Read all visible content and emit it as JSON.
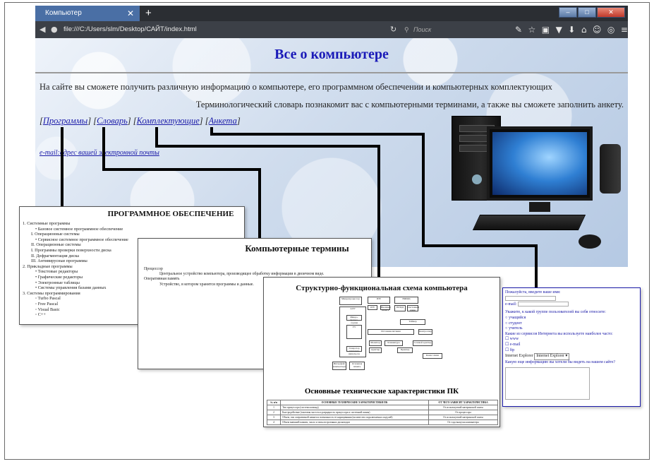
{
  "browser": {
    "tab_title": "Компьютер",
    "tab_close": "✕",
    "new_tab": "+",
    "url": "file:///C:/Users/slm/Desktop/САЙТ/index.html",
    "search_placeholder": "Поиск",
    "window_buttons": [
      "–",
      "□",
      "✕"
    ],
    "toolbar_icons": [
      "wrench-icon",
      "star-icon",
      "clipboard-icon",
      "pocket-icon",
      "download-icon",
      "home-icon",
      "chat-icon",
      "sync-icon",
      "menu-icon"
    ]
  },
  "page": {
    "title": "Все о компьютере",
    "intro1": "На сайте вы сможете получить различную информацию о компьютере, его программном обеспечении и компьютерных комплектующих",
    "intro2": "Терминологический словарь познакомит вас с компьютерными терминами, а также вы сможете заполнить анкету.",
    "nav": [
      "Программы",
      "Словарь",
      "Комплектующие",
      "Анкета"
    ],
    "email_link": "e-mail:адрес вашей электронной почты"
  },
  "software_window": {
    "title": "ПРОГРАММНОЕ ОБЕСПЕЧЕНИЕ",
    "items": [
      {
        "level": "l1",
        "text": "1. Системные программы"
      },
      {
        "level": "l2",
        "text": "• Базовое системное программное обеспечение"
      },
      {
        "level": "l3",
        "text": "I. Операционные системы"
      },
      {
        "level": "l2",
        "text": "• Сервисное системное программное обеспечение"
      },
      {
        "level": "l3",
        "text": "II. Операционные системы"
      },
      {
        "level": "l3",
        "text": "I. Программы проверки поверхности диска"
      },
      {
        "level": "l3",
        "text": "II. Дефрагментация диска"
      },
      {
        "level": "l3",
        "text": "III. Антивирусные программы"
      },
      {
        "level": "l1",
        "text": "2. Прикладные программы"
      },
      {
        "level": "l2",
        "text": "• Текстовые редакторы"
      },
      {
        "level": "l2",
        "text": "• Графические редакторы"
      },
      {
        "level": "l2",
        "text": "• Электронные таблицы"
      },
      {
        "level": "l2",
        "text": "• Системы управления базами данных"
      },
      {
        "level": "l1",
        "text": "3. Системы программирования"
      },
      {
        "level": "l2",
        "text": "◦ Turbo Pascal"
      },
      {
        "level": "l2",
        "text": "◦ Free Pascal"
      },
      {
        "level": "l2",
        "text": "◦ Visual Basic"
      },
      {
        "level": "l2",
        "text": "◦ C++"
      }
    ]
  },
  "terms_window": {
    "title": "Компьютерные термины",
    "lines": [
      {
        "ind": false,
        "text": "Процессор"
      },
      {
        "ind": true,
        "text": "Центральное устройство компьютера, производящее обработку информации в двоичном виде."
      },
      {
        "ind": false,
        "text": "Оперативная память"
      },
      {
        "ind": true,
        "text": "Устройство, в котором хранятся программы и данные."
      }
    ]
  },
  "components_window": {
    "title": "Структурно-функциональная схема компьютера",
    "diagram_boxes": [
      "Микропроцессор",
      "АЛУ",
      "Микро-процес-сорная память",
      "УУ",
      "Генератор тактовых импульсов",
      "Интерфейс компьютера",
      "Основная память",
      "ПЗУ",
      "ОЗУ",
      "Внешняя память",
      "НЖМД",
      "НГМД",
      "Системная шина",
      "Источник питания",
      "Таймер",
      "Контроллер",
      "Монитор",
      "Адаптер",
      "Клавиатура",
      "Принтер",
      "Сетевой адаптер",
      "Канал связи"
    ],
    "subtitle": "Основные технические характеристики ПК",
    "table_headers": [
      "№ п/п",
      "ОСНОВНЫЕ ТЕХНИЧЕСКИЕ ХАРАКТЕРИСТИКИ ПК",
      "ОТ ЧЕГО ЗАВИСИТ ХАРАКТЕРИСТИКА"
    ],
    "table_rows": [
      [
        "1",
        "Тип процессора (система команд)",
        "От используемой материнской платы"
      ],
      [
        "2",
        "Быстродействие (тактовая частота и разрядность процессора и системной шины)",
        "От процессора"
      ],
      [
        "3",
        "Объем, тип оперативной памяти и возможность ее наращивания (количество подключаемых модулей)",
        "От используемой материнской платы"
      ],
      [
        "4",
        "Объем внешней памяти, число и типы встроенных дисководов",
        "От года выпуска компьютера"
      ]
    ]
  },
  "survey_window": {
    "greeting": "Пожалуйста, введите ваше имя:",
    "email_label": "e-mail:",
    "group_question": "Укажите, к какой группе пользователей вы себя относите:",
    "groups": [
      "учащийся",
      "студент",
      "учитель"
    ],
    "services_question": "Какие из сервисов Интернета вы используете наиболее часто:",
    "services": [
      "www",
      "e-mail",
      "ftp"
    ],
    "browser_label": "Internet Explorer",
    "browser_select": "Internet Explorer",
    "info_question": "Какую еще информацию вы хотели бы видеть на нашем сайте?"
  }
}
